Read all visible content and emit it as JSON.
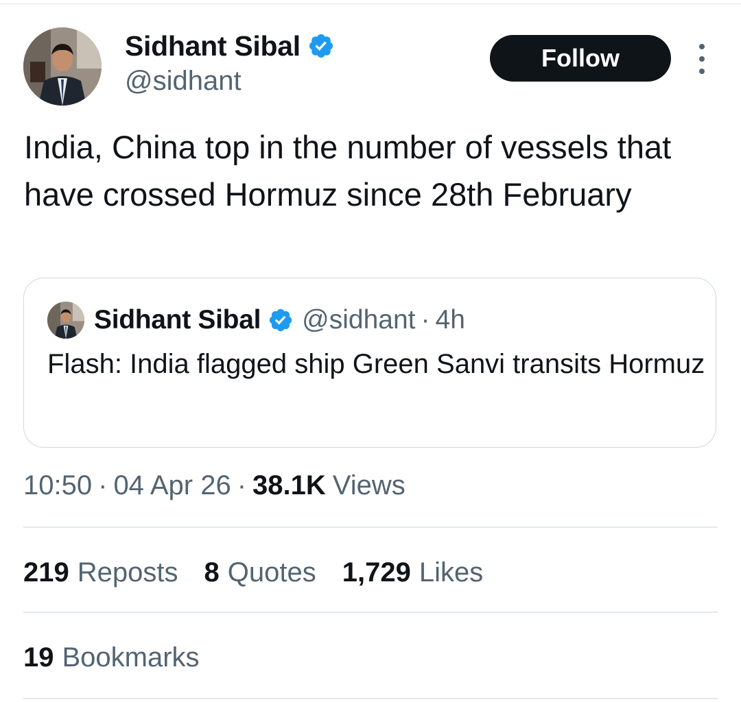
{
  "author": {
    "name": "Sidhant Sibal",
    "handle": "@sidhant",
    "verified": true,
    "verified_color": "#1d9bf0"
  },
  "actions": {
    "follow_label": "Follow",
    "more_icon": "more-vertical-icon"
  },
  "tweet": {
    "text": "India, China top in the number of vessels that have crossed Hormuz since 28th February"
  },
  "quoted_tweet": {
    "name": "Sidhant Sibal",
    "handle": "@sidhant",
    "separator": "·",
    "time": "4h",
    "text": "Flash: India flagged ship Green Sanvi transits Hormuz"
  },
  "meta": {
    "time": "10:50",
    "separator": "·",
    "date": "04 Apr 26",
    "views_count": "38.1K",
    "views_label": "Views"
  },
  "stats": {
    "reposts_count": "219",
    "reposts_label": "Reposts",
    "quotes_count": "8",
    "quotes_label": "Quotes",
    "likes_count": "1,729",
    "likes_label": "Likes",
    "bookmarks_count": "19",
    "bookmarks_label": "Bookmarks"
  },
  "colors": {
    "text_primary": "#0f1419",
    "text_secondary": "#536471",
    "border": "#cfd9de",
    "follow_bg": "#0f1419",
    "follow_text": "#ffffff"
  }
}
